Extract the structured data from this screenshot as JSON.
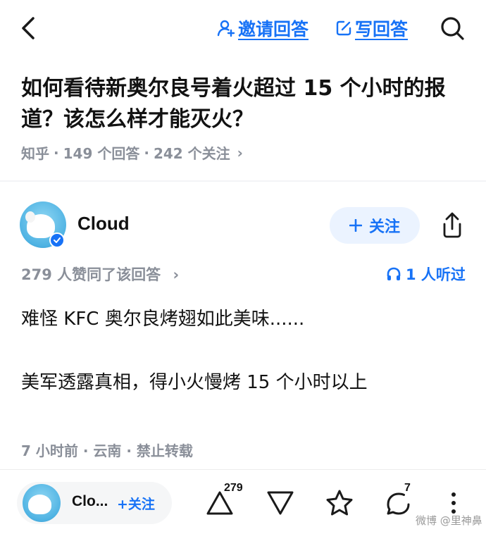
{
  "header": {
    "invite_label": "邀请回答",
    "write_label": "写回答"
  },
  "question": {
    "title": "如何看待新奥尔良号着火超过 15 个小时的报道？该怎么样才能灭火？",
    "source": "知乎",
    "answers": "149 个回答",
    "followers": "242 个关注",
    "separator": "·",
    "chevron": "›"
  },
  "answer": {
    "author": "Cloud",
    "follow_label": "关注",
    "agree_text": "279 人赞同了该回答",
    "agree_chevron": "›",
    "listen_text": "1 人听过",
    "paragraphs": [
      "难怪 KFC 奥尔良烤翅如此美味......",
      "美军透露真相，得小火慢烤 15 个小时以上"
    ],
    "meta": "7 小时前 · 云南 · 禁止转载"
  },
  "bottom_bar": {
    "author_short": "Clo...",
    "follow_label": "+关注",
    "upvote_count": "279",
    "comment_count": "7",
    "watermark": "微博 @里神鼻"
  },
  "colors": {
    "accent": "#1772f6",
    "text": "#121212",
    "muted": "#8a8f99"
  }
}
